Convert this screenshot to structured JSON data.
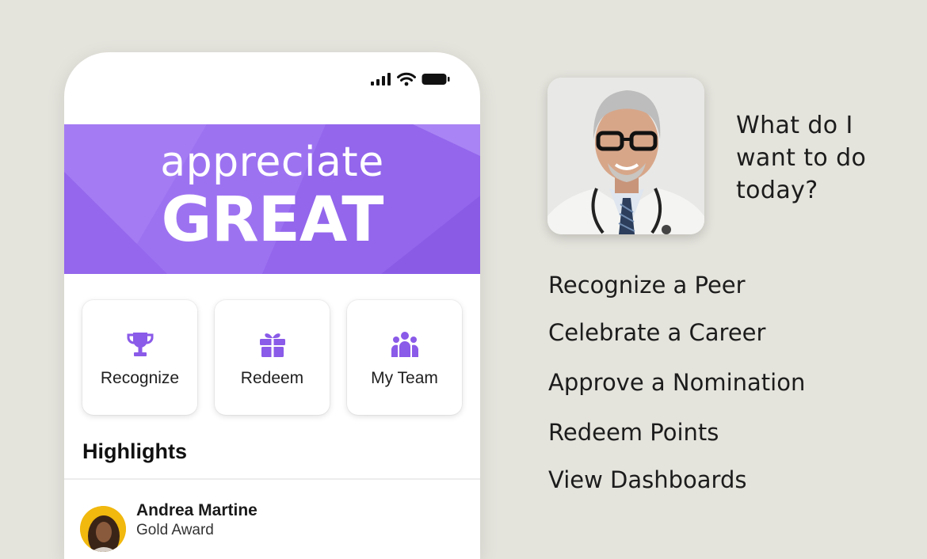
{
  "phone": {
    "banner": {
      "line1": "appreciate",
      "line2": "GREAT",
      "background": "#9a6ff0"
    },
    "actions": [
      {
        "label": "Recognize",
        "icon": "trophy-icon"
      },
      {
        "label": "Redeem",
        "icon": "gift-icon"
      },
      {
        "label": "My Team",
        "icon": "team-icon"
      }
    ],
    "accent": "#8a5ae8",
    "highlights": {
      "title": "Highlights",
      "items": [
        {
          "name": "Andrea Martine",
          "subtitle": "Gold Award"
        }
      ]
    }
  },
  "assistant": {
    "prompt": "What do I want to do today?",
    "options": [
      "Recognize a Peer",
      "Celebrate a Career",
      "Approve a Nomination",
      "Redeem Points",
      "View Dashboards"
    ]
  }
}
